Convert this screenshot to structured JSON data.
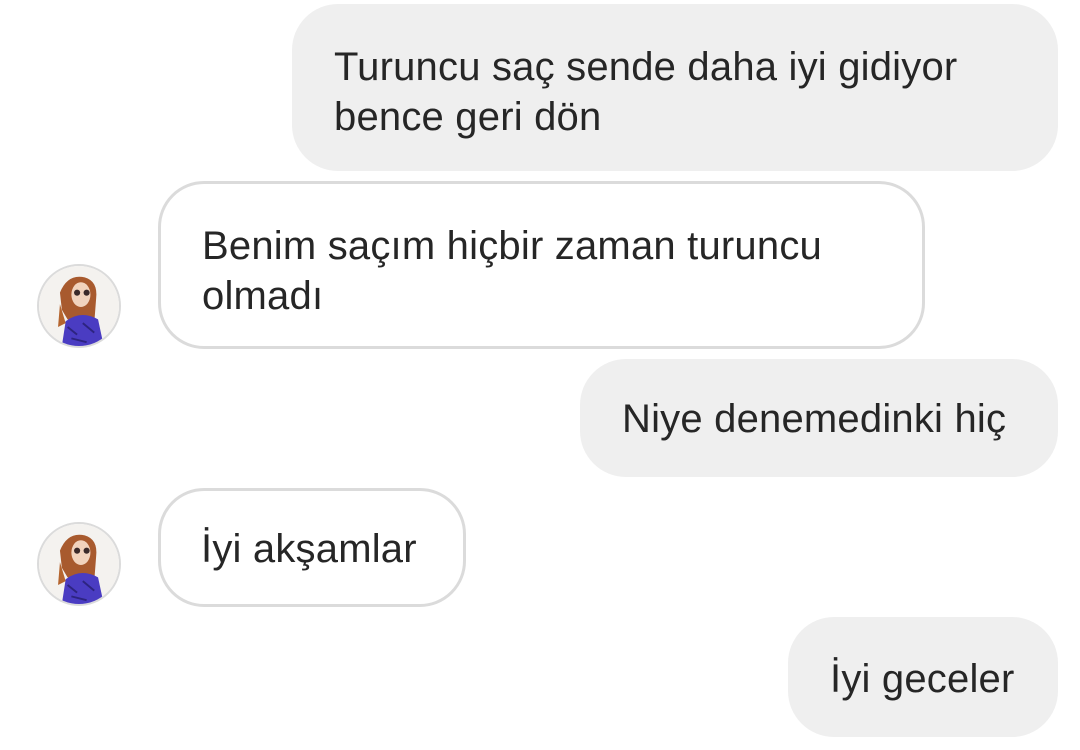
{
  "conversation": {
    "messages": [
      {
        "sender": "me",
        "lines": [
          "Turuncu saç sende daha iyi gidiyor",
          "bence geri dön"
        ]
      },
      {
        "sender": "other",
        "lines": [
          "Benim saçım hiçbir zaman turuncu",
          "olmadı"
        ],
        "avatar": "profile-avatar"
      },
      {
        "sender": "me",
        "lines": [
          "Niye denemedinki hiç"
        ]
      },
      {
        "sender": "other",
        "lines": [
          "İyi akşamlar"
        ],
        "avatar": "profile-avatar"
      },
      {
        "sender": "me",
        "lines": [
          "İyi geceler"
        ]
      }
    ]
  },
  "colors": {
    "sent_bubble_bg": "#efefef",
    "received_bubble_border": "#dbdbdb",
    "text": "#262626"
  }
}
